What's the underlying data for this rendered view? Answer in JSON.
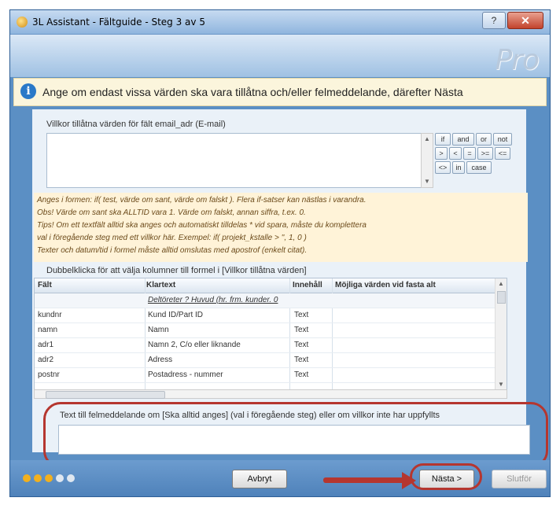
{
  "window": {
    "title": "3L Assistant - Fältguide - Steg 3 av 5",
    "help_label": "?",
    "close_label": "✕",
    "logo_text": "Pro"
  },
  "info": {
    "message": "Ange om endast vissa värden ska vara tillåtna och/eller felmeddelande, därefter Nästa"
  },
  "conditions": {
    "label": "Villkor tillåtna värden för fält email_adr (E-mail)",
    "value": "",
    "operators": [
      "if",
      "and",
      "or",
      "not",
      ">",
      "<",
      "=",
      ">=",
      "<=",
      "<>",
      "in",
      "case"
    ]
  },
  "hint": {
    "lines": [
      "Anges i formen: if( test, värde om sant, värde om falskt ). Flera if-satser kan nästlas i varandra.",
      "Obs! Värde om sant ska ALLTID vara 1. Värde om falskt, annan siffra, t.ex. 0.",
      "Tips! Om ett textfält alltid ska anges och automatiskt tilldelas * vid spara, måste du komplettera",
      "val i föregående steg med ett villkor här. Exempel: if( projekt_kstalle > '', 1, 0 )",
      "Texter och datum/tid i formel måste alltid omslutas med apostrof (enkelt citat)."
    ]
  },
  "grid": {
    "label": "Dubbelklicka för att välja kolumner till formel i [Villkor tillåtna värden]",
    "headers": [
      "Fält",
      "Klartext",
      "Innehåll",
      "Möjliga värden vid fasta alt"
    ],
    "rows": [
      [
        "",
        "Deltöreter ? Huvud (hr. frm. kunder. 0",
        "",
        ""
      ],
      [
        "kundnr",
        "Kund ID/Part ID",
        "Text",
        ""
      ],
      [
        "namn",
        "Namn",
        "Text",
        ""
      ],
      [
        "adr1",
        "Namn 2, C/o eller liknande",
        "Text",
        ""
      ],
      [
        "adr2",
        "Adress",
        "Text",
        ""
      ],
      [
        "postnr",
        "Postadress - nummer",
        "Text",
        ""
      ]
    ]
  },
  "error_message": {
    "label": "Text till felmeddelande om [Ska alltid anges] (val i föregående steg) eller om villkor inte har uppfyllts",
    "value": ""
  },
  "footer": {
    "cancel_label": "Avbryt",
    "next_label": "Nästa >",
    "finish_label": "Slutför",
    "progress": {
      "current_step": 3,
      "total_steps": 5
    }
  },
  "colors": {
    "accent": "#b5362f",
    "progress_done": "#f2b01e",
    "progress_todo": "#dfe7f0"
  }
}
